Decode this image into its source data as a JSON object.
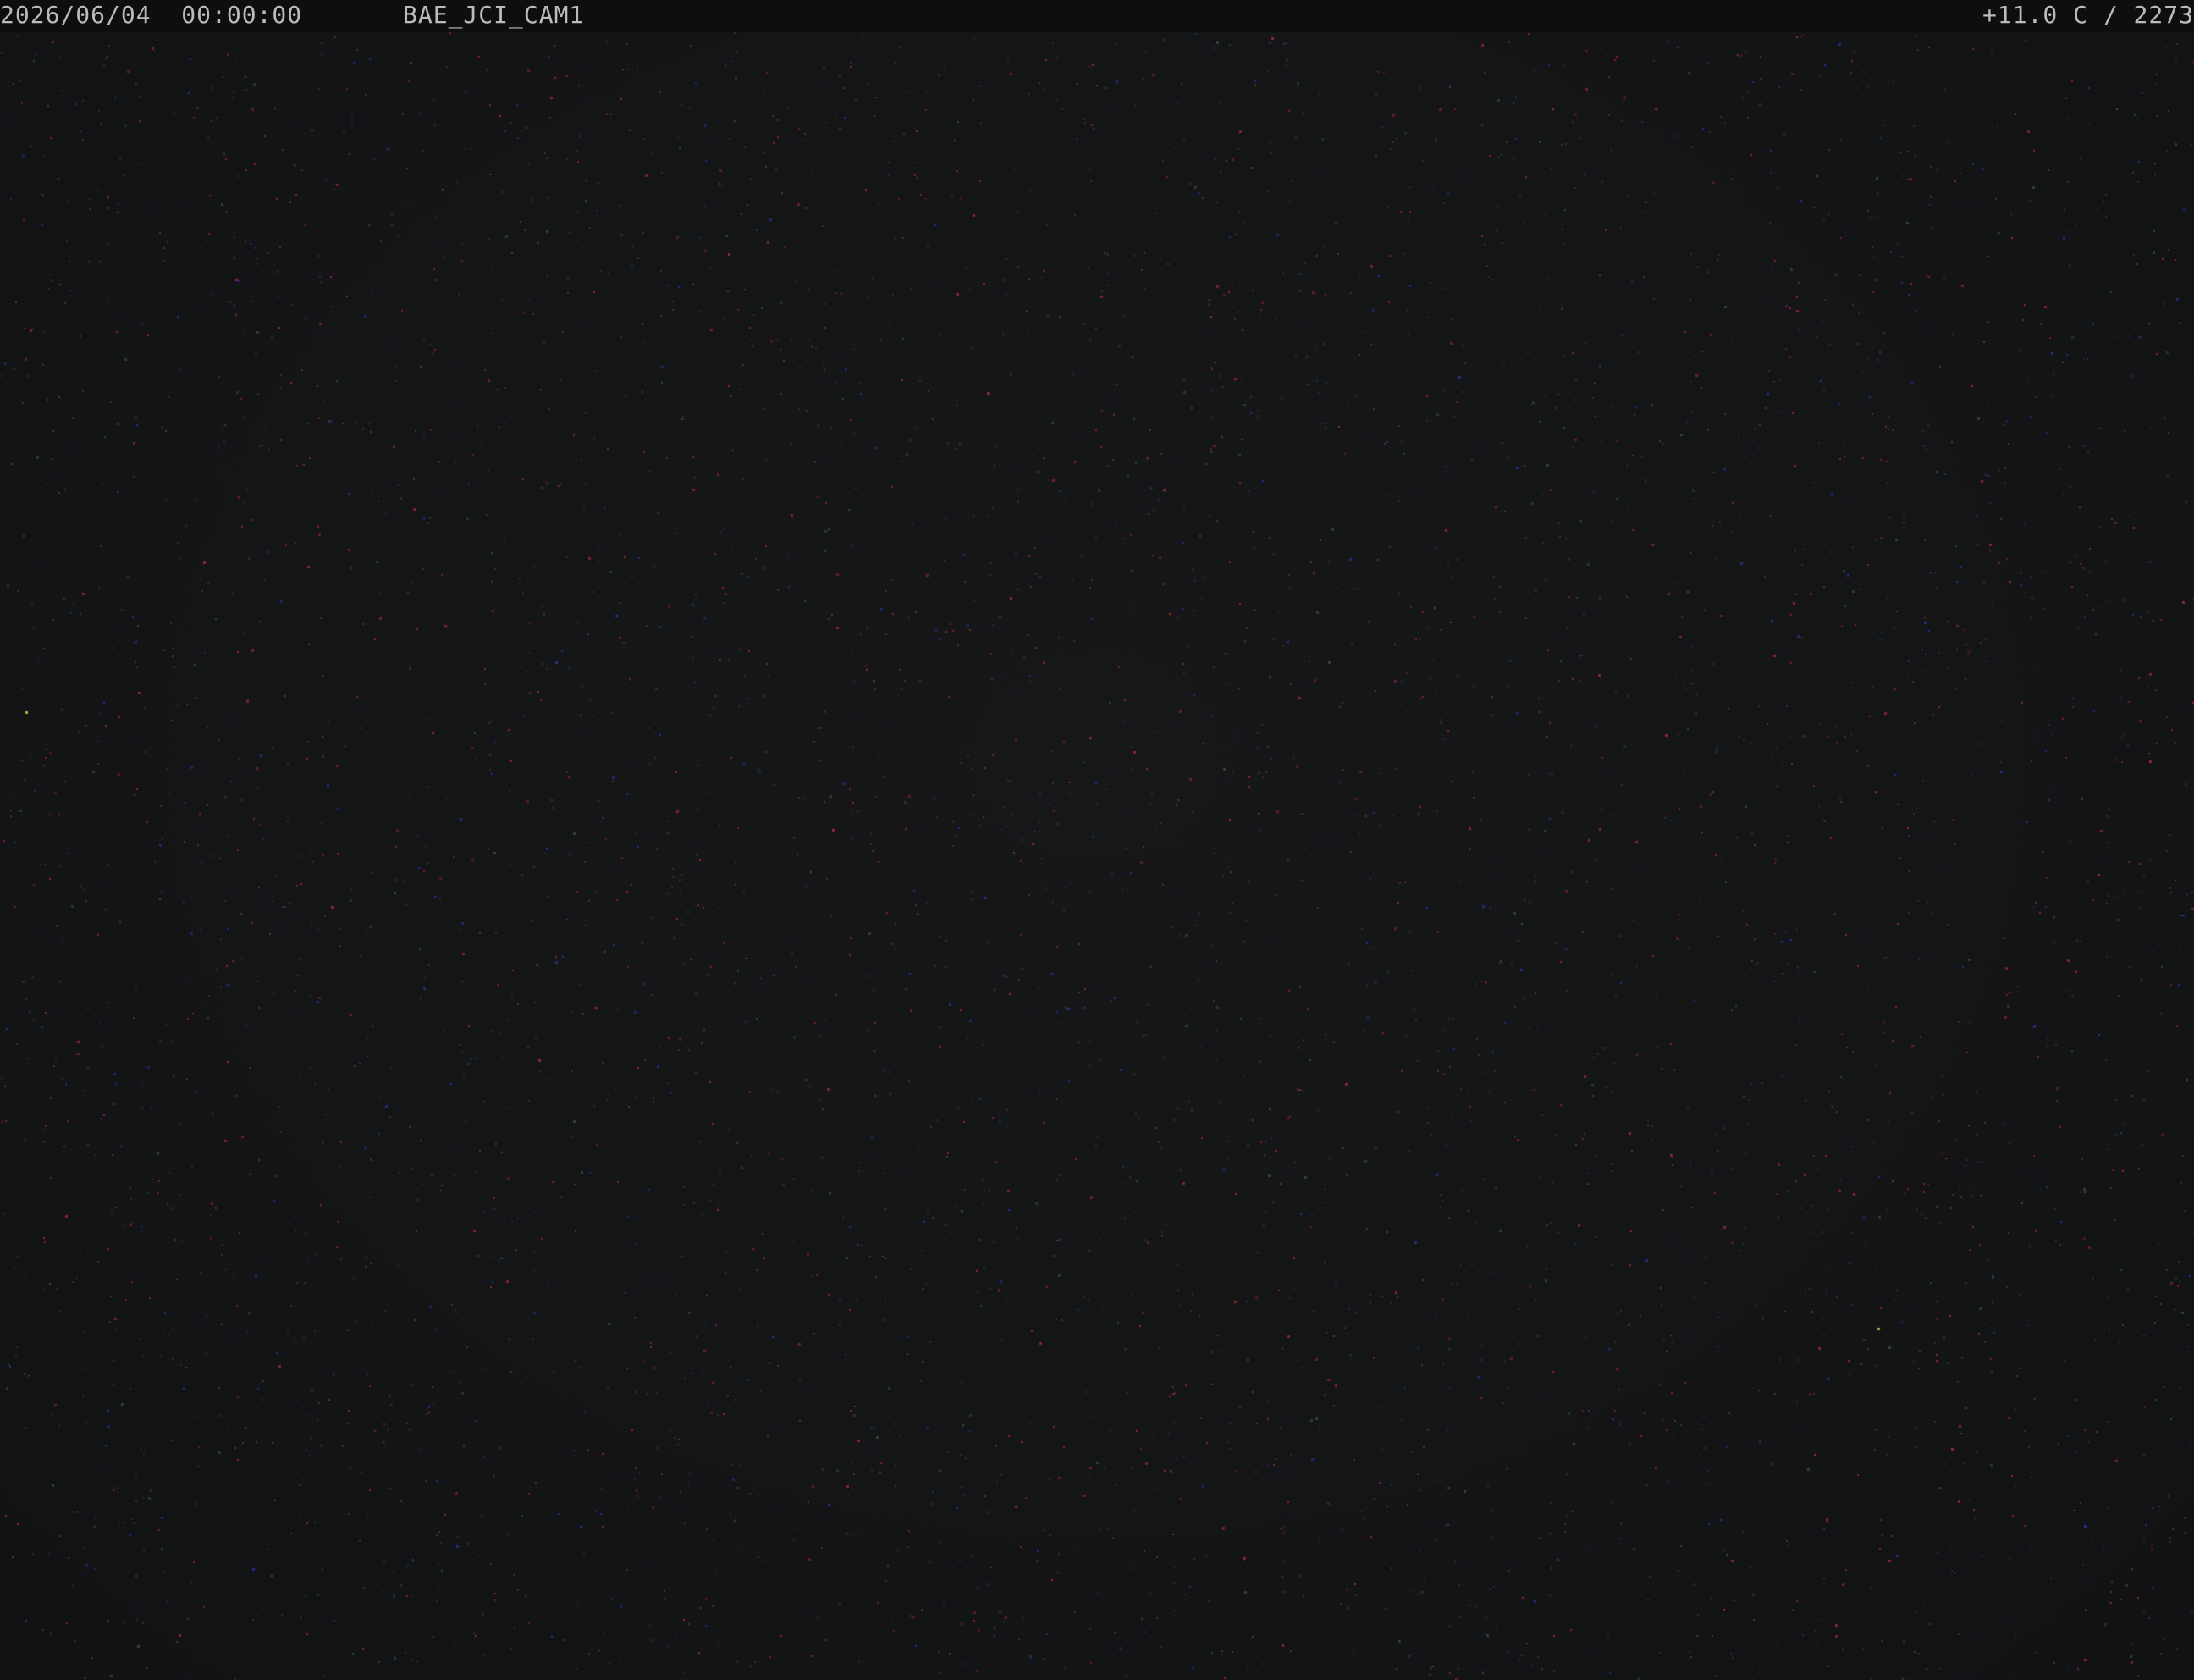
{
  "osd": {
    "datetime": "2026/06/04  00:00:00",
    "camera_name": "BAE_JCI_CAM1",
    "temperature_reading": "+11.0 C / 2273"
  },
  "colors": {
    "sky_background": "#141516",
    "osd_text": "#b9bbbd",
    "noise_red": "#a02838",
    "noise_green": "#3a4a3a",
    "noise_blue": "#3030a0",
    "noise_yellow": "#c8c840"
  }
}
